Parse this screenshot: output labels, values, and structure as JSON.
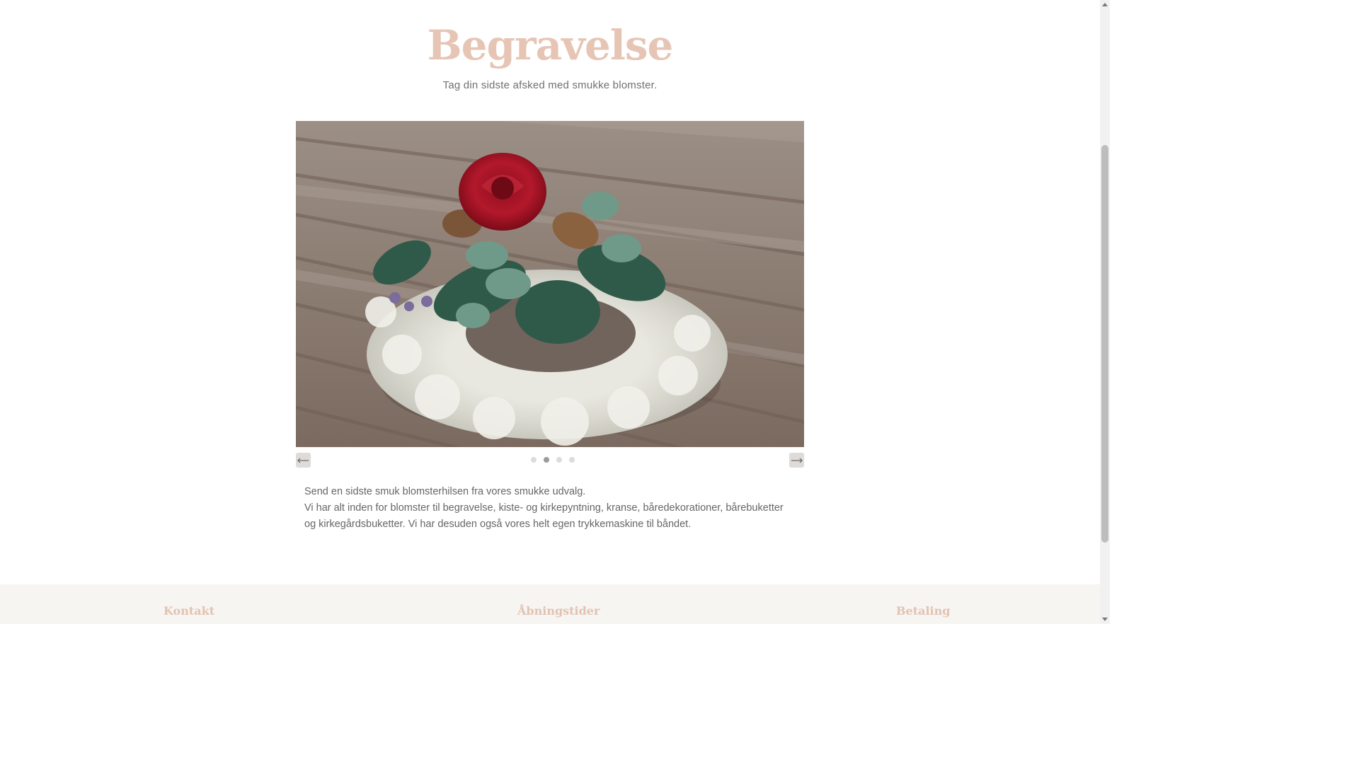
{
  "page": {
    "title": "Begravelse",
    "subtitle": "Tag din sidste afsked med smukke blomster."
  },
  "slider": {
    "image_alt": "Krans med rød rose, kogler, eukalyptus og hvid mos",
    "active_index": 1,
    "slide_count": 4,
    "prev_icon": "arrow-left-icon",
    "next_icon": "arrow-right-icon"
  },
  "description": {
    "line1": "Send en sidste smuk blomsterhilsen fra vores smukke udvalg.",
    "line2": "Vi har alt inden for blomster til begravelse, kiste- og kirkepyntning, kranse, båredekorationer, bårebuketter og kirkegårdsbuketter. Vi har desuden også vores helt egen trykkemaskine til båndet."
  },
  "footer": {
    "kontakt": "Kontakt",
    "abningstider": "Åbningstider",
    "betaling": "Betaling"
  },
  "colors": {
    "accent": "#e6c5b5",
    "text": "#666666",
    "footer_bg": "#f7f5f2"
  }
}
